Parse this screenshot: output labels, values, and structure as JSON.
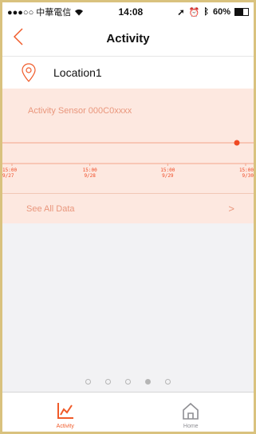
{
  "status": {
    "carrier": "●●●○○ 中華電信",
    "wifi": "wifi-icon",
    "time": "14:08",
    "battery": "60%"
  },
  "navbar": {
    "back_icon": "chevron-left-icon",
    "title": "Activity"
  },
  "location": {
    "icon": "location-pin-icon",
    "name": "Location1"
  },
  "sensor": {
    "title": "Activity Sensor 000C0xxxx",
    "chart_data": {
      "type": "scatter",
      "x_ticks": [
        {
          "time": "15:00",
          "date": "9/27"
        },
        {
          "time": "15:00",
          "date": "9/28"
        },
        {
          "time": "15:00",
          "date": "9/29"
        },
        {
          "time": "15:00",
          "date": "9/30"
        }
      ],
      "points": [
        {
          "x": "9/30",
          "y": 1
        }
      ],
      "colors": {
        "line": "#f4a58a",
        "point": "#ef4a24"
      }
    }
  },
  "see_all": {
    "label": "See All Data",
    "chevron": ">"
  },
  "pager": {
    "count": 5,
    "active": 3
  },
  "tabs": [
    {
      "label": "Activity",
      "icon": "activity-chart-icon",
      "active": true
    },
    {
      "label": "Home",
      "icon": "home-icon",
      "active": false
    }
  ],
  "colors": {
    "accent": "#f05a28",
    "card_bg": "#fde8e0",
    "inactive": "#8e8e93"
  }
}
